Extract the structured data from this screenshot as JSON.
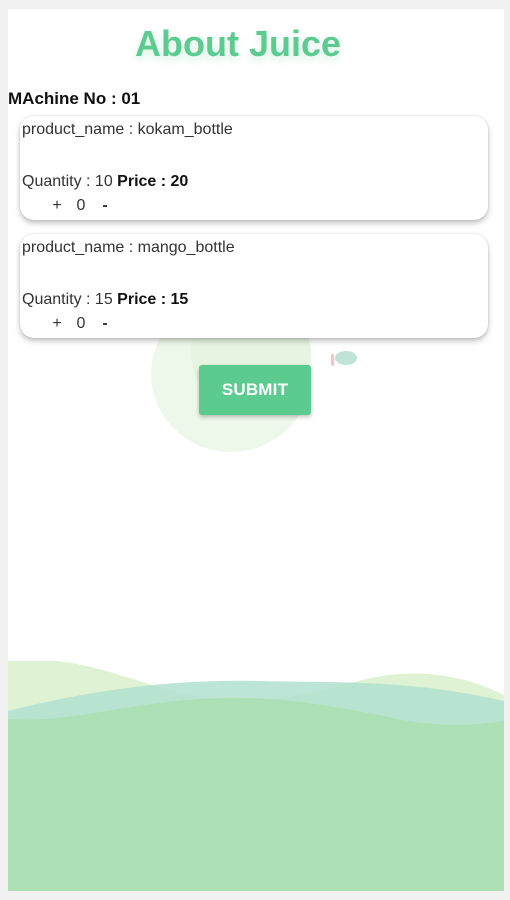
{
  "header": {
    "title": "About Juice"
  },
  "machine": {
    "label": "MAchine No : 01"
  },
  "products": [
    {
      "name_text": "product_name : kokam_bottle",
      "quantity_text": "Quantity : 10",
      "price_text": "Price : 20",
      "plus_label": "+",
      "count": "0",
      "minus_label": "-"
    },
    {
      "name_text": "product_name : mango_bottle",
      "quantity_text": "Quantity : 15",
      "price_text": "Price : 15",
      "plus_label": "+",
      "count": "0",
      "minus_label": "-"
    }
  ],
  "actions": {
    "submit_label": "SUBMIT"
  },
  "colors": {
    "accent": "#5ccb8f",
    "wave_main": "#ace0b4",
    "wave_light": "#d7efc9",
    "wave_teal": "#a9dccb"
  }
}
